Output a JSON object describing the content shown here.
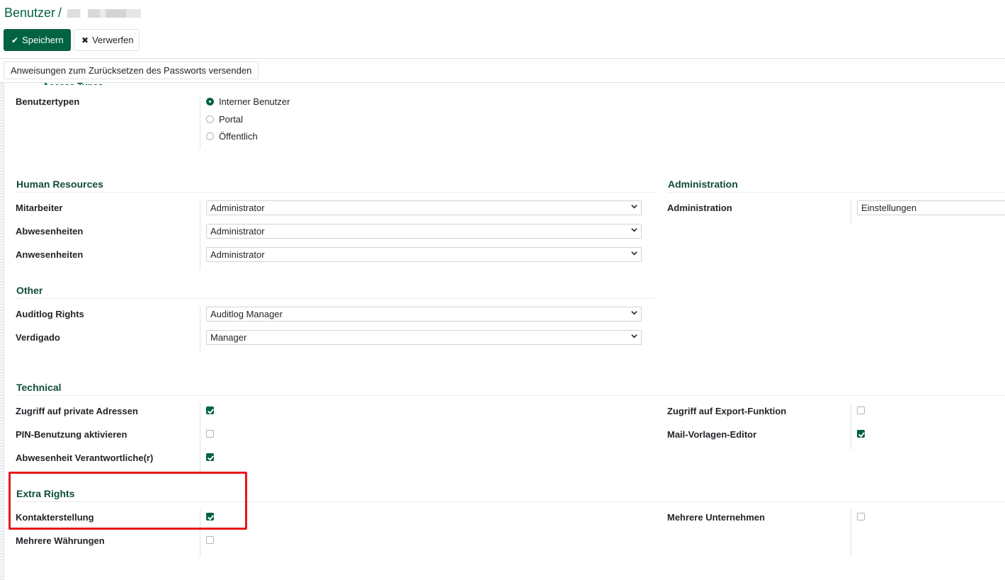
{
  "breadcrumb": {
    "parent": "Benutzer",
    "separator": "/"
  },
  "toolbar": {
    "save_label": "Speichern",
    "discard_label": "Verwerfen"
  },
  "actions": {
    "reset_password_label": "Anweisungen zum Zurücksetzen des Passworts versenden"
  },
  "user_type": {
    "label": "Benutzertypen",
    "options": [
      "Interner Benutzer",
      "Portal",
      "Öffentlich"
    ],
    "selected": "Interner Benutzer"
  },
  "human_resources": {
    "title": "Human Resources",
    "fields": [
      {
        "label": "Mitarbeiter",
        "value": "Administrator"
      },
      {
        "label": "Abwesenheiten",
        "value": "Administrator"
      },
      {
        "label": "Anwesenheiten",
        "value": "Administrator"
      }
    ]
  },
  "administration": {
    "title": "Administration",
    "fields": [
      {
        "label": "Administration",
        "value": "Einstellungen"
      }
    ]
  },
  "other": {
    "title": "Other",
    "fields": [
      {
        "label": "Auditlog Rights",
        "value": "Auditlog Manager"
      },
      {
        "label": "Verdigado",
        "value": "Manager"
      }
    ]
  },
  "technical": {
    "title": "Technical",
    "left": [
      {
        "label": "Zugriff auf private Adressen",
        "checked": true
      },
      {
        "label": "PIN-Benutzung aktivieren",
        "checked": false
      },
      {
        "label": "Abwesenheit Verantwortliche(r)",
        "checked": true
      }
    ],
    "right": [
      {
        "label": "Zugriff auf Export-Funktion",
        "checked": false
      },
      {
        "label": "Mail-Vorlagen-Editor",
        "checked": true
      }
    ]
  },
  "extra_rights": {
    "title": "Extra Rights",
    "left": [
      {
        "label": "Kontakterstellung",
        "checked": true
      },
      {
        "label": "Mehrere Währungen",
        "checked": false
      }
    ],
    "right": [
      {
        "label": "Mehrere Unternehmen",
        "checked": false
      }
    ]
  },
  "colors": {
    "brand": "#016344",
    "highlight": "#e8161c"
  }
}
